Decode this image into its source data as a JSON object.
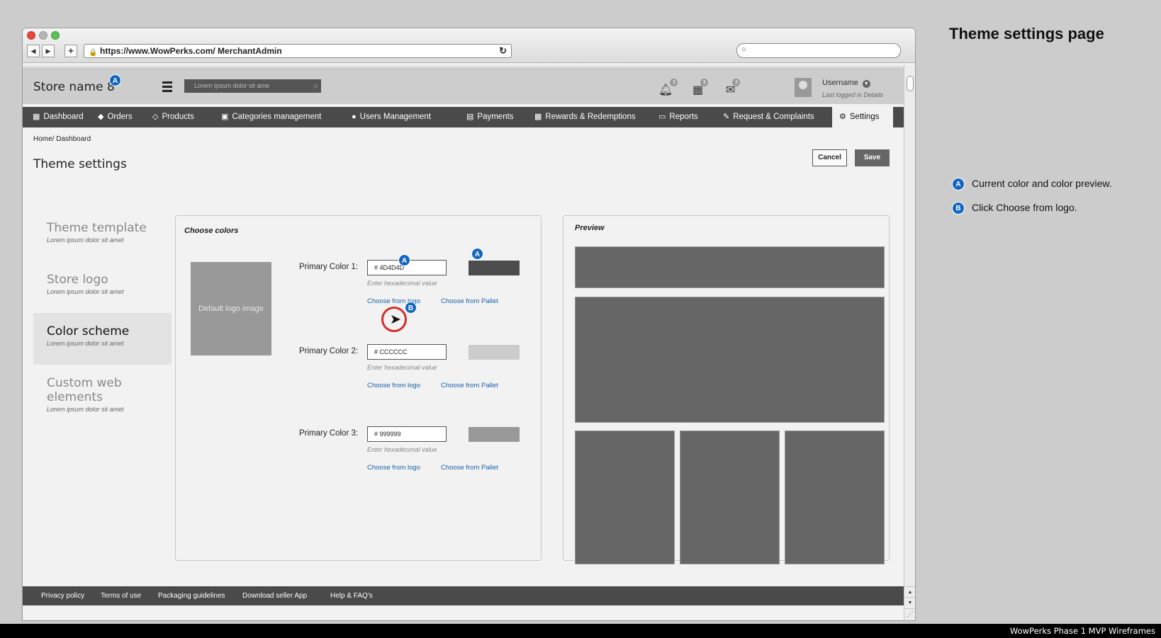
{
  "browser": {
    "url": "https://www.WowPerks.com/ MerchantAdmin",
    "back": "◀",
    "forward": "▶",
    "newtab": "+"
  },
  "header": {
    "store_name": "Store name 8",
    "badge_a": "A",
    "search_placeholder": "Lorem ipsum dolor sit ame",
    "notif_count": "3",
    "calendar_count": "3",
    "mail_count": "3",
    "username": "Username",
    "last_logged": "Last logged in Details"
  },
  "nav": {
    "dashboard": "Dashboard",
    "orders": "Orders",
    "products": "Products",
    "categories": "Categories management",
    "users": "Users Management",
    "payments": "Payments",
    "rewards": "Rewards & Redemptions",
    "reports": "Reports",
    "requests": "Request & Complaints",
    "settings": "Settings"
  },
  "breadcrumb": "Home/ Dashboard",
  "page_title": "Theme settings",
  "actions": {
    "cancel": "Cancel",
    "save": "Save"
  },
  "sidebar": [
    {
      "title": "Theme template",
      "sub": "Lorem ipsum dolor sit amet"
    },
    {
      "title": "Store logo",
      "sub": "Lorem ipsum dolor sit amet"
    },
    {
      "title": "Color scheme",
      "sub": "Lorem ipsum dolor sit amet"
    },
    {
      "title": "Custom web elements",
      "sub": "Lorem ipsum dolor sit amet"
    }
  ],
  "colors_panel": {
    "title": "Choose colors",
    "logo_placeholder": "Default logo image",
    "hint": "Enter hexadecimal value",
    "choose_logo": "Choose from logo",
    "choose_pallet": "Choose from Pallet",
    "rows": [
      {
        "label": "Primary Color 1:",
        "value": "# 4D4D4D",
        "swatch": "#4d4d4d"
      },
      {
        "label": "Primary Color 2:",
        "value": "# CCCCCC",
        "swatch": "#cccccc"
      },
      {
        "label": "Primary Color 3:",
        "value": "# 999999",
        "swatch": "#999999"
      }
    ],
    "badge_b": "B"
  },
  "preview": {
    "title": "Preview"
  },
  "footer": {
    "privacy": "Privacy policy",
    "terms": "Terms of use",
    "packaging": "Packaging guidelines",
    "download": "Download seller App",
    "help": "Help & FAQ's"
  },
  "notes": {
    "title": "Theme settings page",
    "items": [
      {
        "badge": "A",
        "text": "Current color and color preview."
      },
      {
        "badge": "B",
        "text": "Click Choose from logo."
      }
    ]
  },
  "footer_caption": "WowPerks Phase 1 MVP Wireframes",
  "colors": {
    "accent_badge": "#1366c0",
    "nav_bg": "#4a4a4a",
    "link": "#1662a8",
    "cursor_ring": "#d42d2d"
  }
}
